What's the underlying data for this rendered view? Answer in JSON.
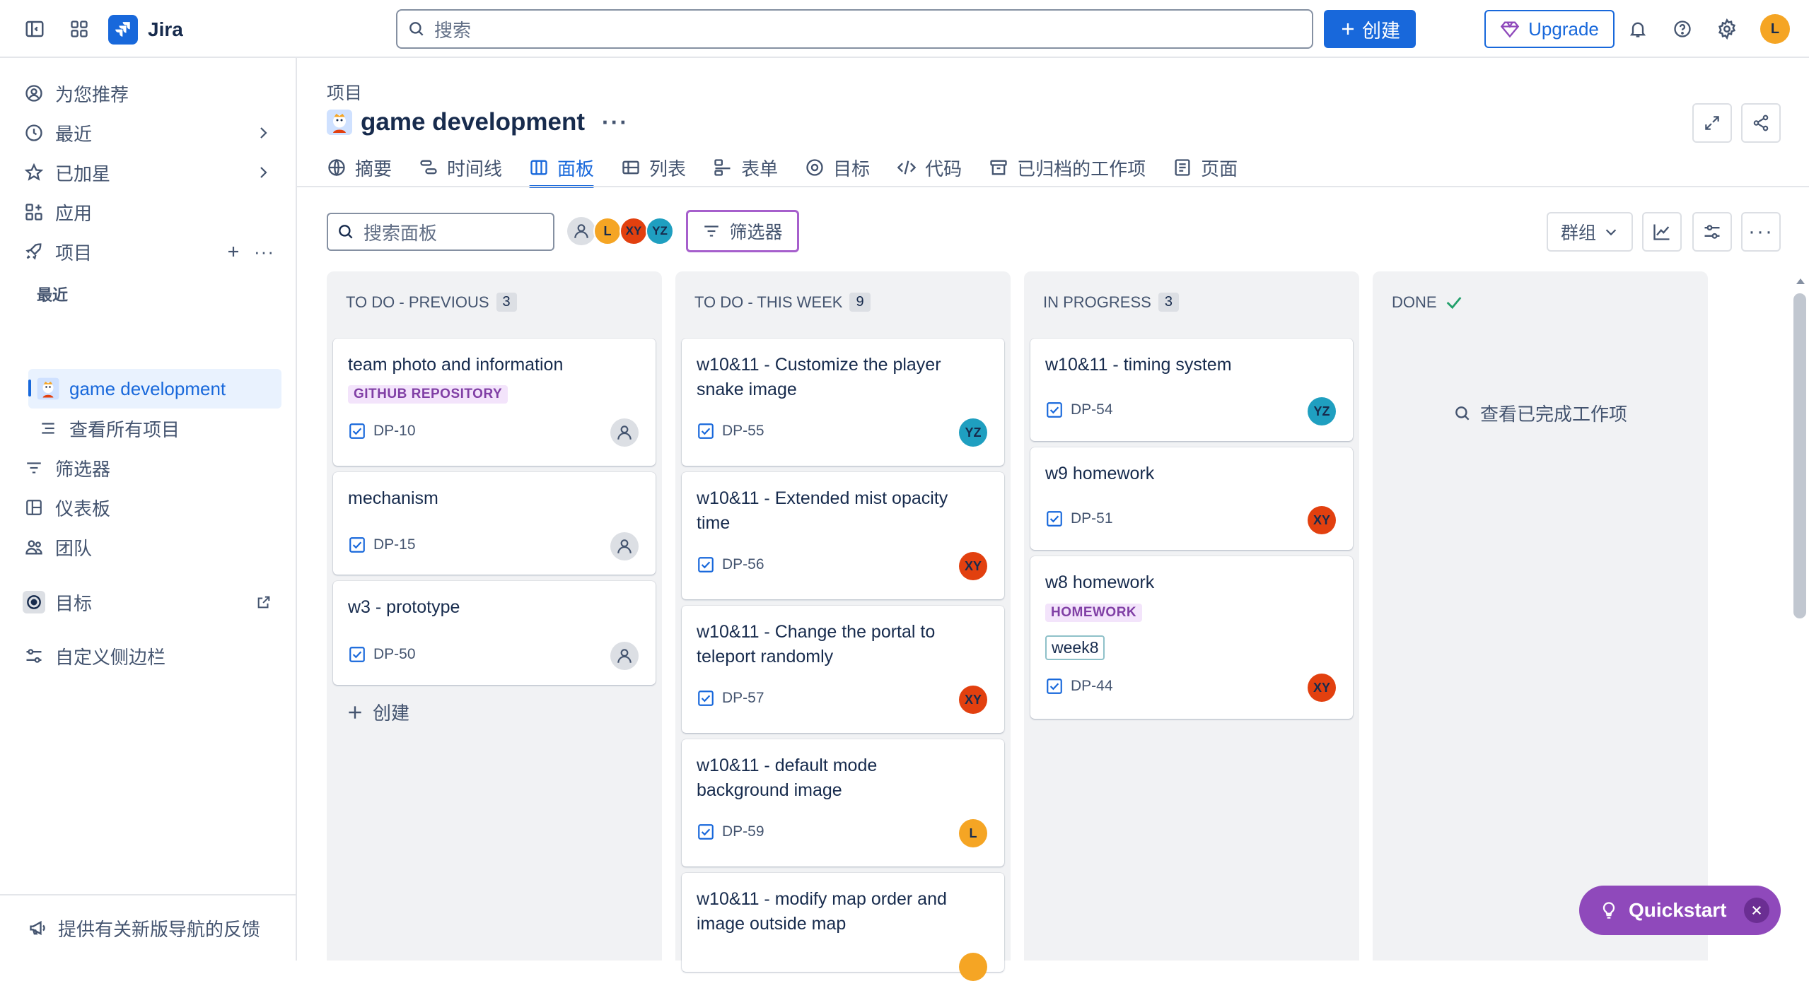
{
  "topbar": {
    "app_name": "Jira",
    "search_placeholder": "搜索",
    "create_label": "创建",
    "upgrade_label": "Upgrade",
    "user_initial": "L"
  },
  "sidebar": {
    "items": [
      {
        "label": "为您推荐"
      },
      {
        "label": "最近"
      },
      {
        "label": "已加星"
      },
      {
        "label": "应用"
      },
      {
        "label": "项目"
      }
    ],
    "recent_section": "最近",
    "project_item": "game development",
    "view_all_projects": "查看所有项目",
    "filters": "筛选器",
    "dashboards": "仪表板",
    "teams": "团队",
    "goals": "目标",
    "customize": "自定义侧边栏",
    "feedback": "提供有关新版导航的反馈"
  },
  "main": {
    "breadcrumb": "项目",
    "project_title": "game development",
    "tabs": [
      {
        "label": "摘要"
      },
      {
        "label": "时间线"
      },
      {
        "label": "面板"
      },
      {
        "label": "列表"
      },
      {
        "label": "表单"
      },
      {
        "label": "目标"
      },
      {
        "label": "代码"
      },
      {
        "label": "已归档的工作项"
      },
      {
        "label": "页面"
      }
    ],
    "board_search_placeholder": "搜索面板",
    "filter_label": "筛选器",
    "group_label": "群组",
    "avatars": [
      {
        "initials": "L",
        "color": "#f5a524"
      },
      {
        "initials": "XY",
        "color": "#e2400f"
      },
      {
        "initials": "YZ",
        "color": "#1f9fc0"
      }
    ]
  },
  "columns": [
    {
      "title": "TO DO - PREVIOUS",
      "count": "3",
      "cards": [
        {
          "title": "team photo and information",
          "label": "GITHUB REPOSITORY",
          "key": "DP-10"
        },
        {
          "title": "mechanism",
          "key": "DP-15"
        },
        {
          "title": "w3 - prototype",
          "key": "DP-50"
        }
      ],
      "create_label": "创建"
    },
    {
      "title": "TO DO - THIS WEEK",
      "count": "9",
      "cards": [
        {
          "title": "w10&11 - Customize the player snake image",
          "key": "DP-55",
          "assignee": "YZ"
        },
        {
          "title": "w10&11 - Extended mist opacity time",
          "key": "DP-56",
          "assignee": "XY"
        },
        {
          "title": "w10&11 - Change the portal to teleport randomly",
          "key": "DP-57",
          "assignee": "XY"
        },
        {
          "title": "w10&11 - default mode background image",
          "key": "DP-59",
          "assignee": "L"
        },
        {
          "title": "w10&11 - modify map order and image outside map"
        }
      ]
    },
    {
      "title": "IN PROGRESS",
      "count": "3",
      "cards": [
        {
          "title": "w10&11 - timing system",
          "key": "DP-54",
          "assignee": "YZ"
        },
        {
          "title": "w9 homework",
          "key": "DP-51",
          "assignee": "XY"
        },
        {
          "title": "w8 homework",
          "label": "HOMEWORK",
          "tag": "week8",
          "key": "DP-44",
          "assignee": "XY"
        }
      ]
    },
    {
      "title": "DONE",
      "view_completed": "查看已完成工作项"
    }
  ],
  "quickstart": {
    "label": "Quickstart"
  },
  "colors": {
    "brand": "#1868db",
    "purple": "#8f49bb",
    "avatar_L": "#f5a524",
    "avatar_XY": "#e2400f",
    "avatar_YZ": "#1f9fc0"
  }
}
